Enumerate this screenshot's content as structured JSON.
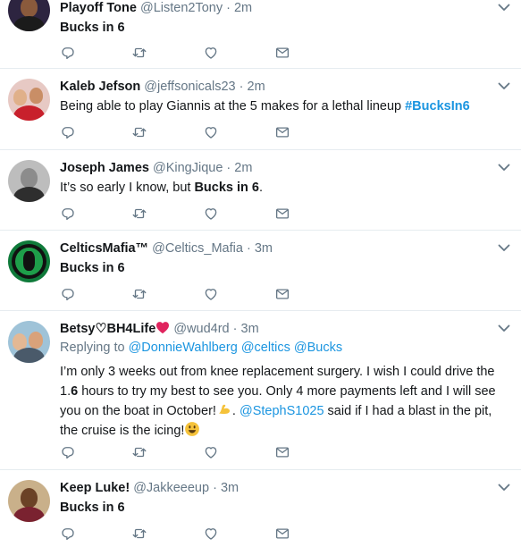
{
  "tweets": [
    {
      "name": "Playoff Tone",
      "handle": "@Listen2Tony",
      "sep": "·",
      "time": "2m",
      "text": "Bucks in 6"
    },
    {
      "name": "Kaleb Jefson",
      "handle": "@jeffsonicals23",
      "sep": "·",
      "time": "2m",
      "text_a": "Being able to play Giannis at the 5 makes for a lethal lineup ",
      "hashtag": "#BucksIn6"
    },
    {
      "name": "Joseph James",
      "handle": "@KingJique",
      "sep": "·",
      "time": "2m",
      "text_a": "It’s so early I know, but ",
      "text_bold": "Bucks in 6",
      "text_c": "."
    },
    {
      "name": "CelticsMafia™",
      "handle": "@Celtics_Mafia",
      "sep": "·",
      "time": "3m",
      "text": "Bucks in 6"
    },
    {
      "name": "Betsy♡BH4Life",
      "handle": "@wud4rd",
      "sep": "·",
      "time": "3m",
      "replying_label": "Replying to ",
      "replying_1": "@DonnieWahlberg",
      "replying_2": "@celtics",
      "replying_3": "@Bucks",
      "text_a": "I’m only 3 weeks out from knee replacement surgery. I wish I could drive the 1.",
      "text_bold": "6",
      "text_b": " hours to try my best to see you. Only 4 more payments left and I will see you on the boat in October!",
      "text_c": ". ",
      "mention": "@StephS1025",
      "text_d": " said if I had a blast in the pit, the cruise is the icing!"
    },
    {
      "name": "Keep Luke!",
      "handle": "@Jakkeeeup",
      "sep": "·",
      "time": "3m",
      "text": "Bucks in 6"
    }
  ],
  "colors": {
    "text": "#14171a",
    "secondary": "#657786",
    "link": "#1b95e0",
    "action_icon": "#657786",
    "divider": "#e6ecf0",
    "heart": "#e0245e"
  },
  "icons": [
    "reply-icon",
    "retweet-icon",
    "like-icon",
    "message-icon",
    "chevron-down-icon",
    "red-heart-emoji",
    "flexed-biceps-emoji",
    "smiley-emoji"
  ]
}
